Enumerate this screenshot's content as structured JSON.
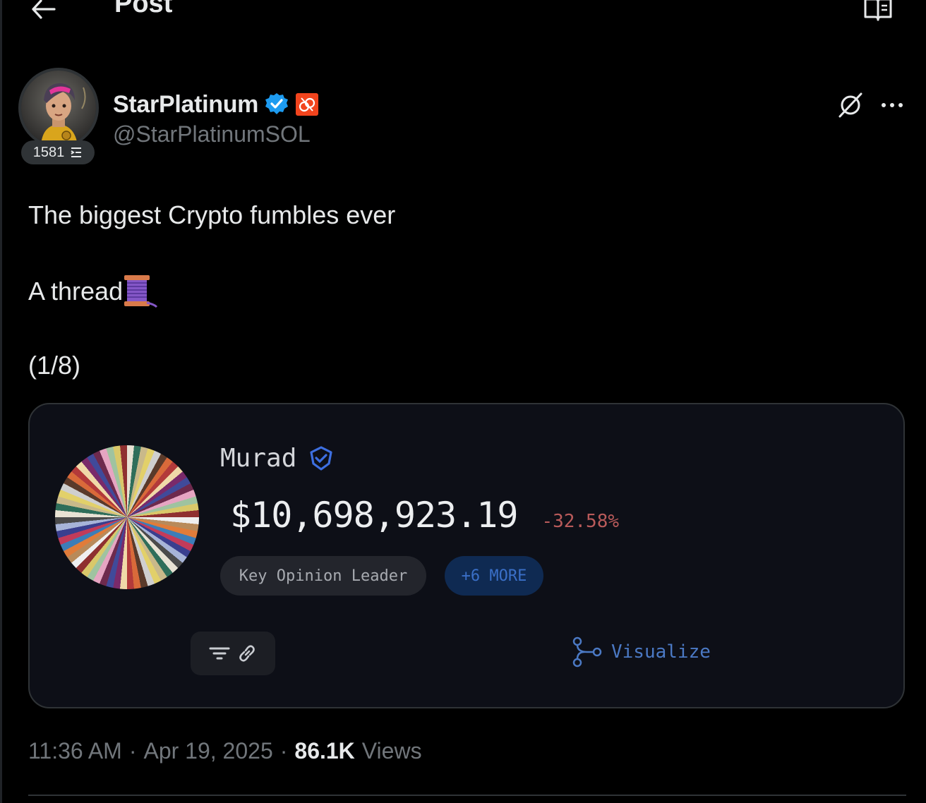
{
  "header": {
    "title": "Post",
    "back_icon": "arrow-left-icon",
    "reader_icon": "book-open-icon"
  },
  "author": {
    "display_name": "StarPlatinum",
    "handle": "@StarPlatinumSOL",
    "score": "1581",
    "verified_badge_color": "#1d9bf0",
    "affiliate_badge_color": "#f2441d"
  },
  "post": {
    "line1": "The biggest Crypto fumbles ever",
    "line2": "A thread",
    "line2_emoji": "🧵",
    "line3": "(1/8)"
  },
  "card": {
    "name": "Murad",
    "balance": "$10,698,923.19",
    "change": "-32.58%",
    "tags": [
      "Key Opinion Leader",
      "+6 MORE"
    ],
    "visualize_label": "Visualize",
    "negative_color": "#b85a5a",
    "accent_color": "#4b79c4"
  },
  "meta": {
    "time": "11:36 AM",
    "date": "Apr 19, 2025",
    "views_count": "86.1K",
    "views_label": "Views",
    "separator": "·"
  }
}
